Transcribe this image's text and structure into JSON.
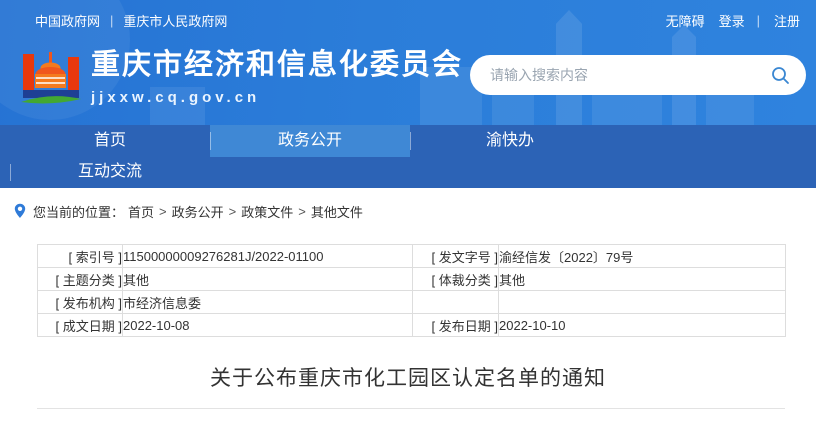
{
  "top_bar": {
    "left_links": [
      "中国政府网",
      "重庆市人民政府网"
    ],
    "right_links": [
      "无障碍",
      "登录",
      "注册"
    ],
    "divider": "|"
  },
  "header": {
    "site_name": "重庆市经济和信息化委员会",
    "site_url": "jjxxw.cq.gov.cn",
    "search_placeholder": "请输入搜索内容"
  },
  "nav": {
    "tabs": [
      {
        "label": "首页",
        "active": false
      },
      {
        "label": "政务公开",
        "active": true
      },
      {
        "label": "渝快办",
        "active": false
      },
      {
        "label": "互动交流",
        "active": false
      }
    ]
  },
  "breadcrumb": {
    "prefix": "您当前的位置：",
    "items": [
      "首页",
      "政务公开",
      "政策文件",
      "其他文件"
    ],
    "separator": ">"
  },
  "doc_meta": {
    "rows": [
      {
        "label1": "[ 索引号 ]",
        "value1": "11500000009276281J/2022-01100",
        "label2": "[ 发文字号 ]",
        "value2": "渝经信发〔2022〕79号"
      },
      {
        "label1": "[ 主题分类 ]",
        "value1": "其他",
        "label2": "[ 体裁分类 ]",
        "value2": "其他"
      },
      {
        "label1": "[ 发布机构 ]",
        "value1": "市经济信息委",
        "label2": "",
        "value2": ""
      },
      {
        "label1": "[ 成文日期 ]",
        "value1": "2022-10-08",
        "label2": "[ 发布日期 ]",
        "value2": "2022-10-10"
      }
    ]
  },
  "article": {
    "title": "关于公布重庆市化工园区认定名单的通知"
  },
  "colors": {
    "header_blue": "#2b7dd9",
    "nav_blue": "#2c63b6",
    "active_tab_blue": "#3f88d5",
    "search_icon_blue": "#3a87d2",
    "pin_blue": "#2f7bd8",
    "table_border": "#dddddd",
    "text_dark": "#333333",
    "logo_orange": "#f0561d",
    "logo_green": "#43a832",
    "logo_navy": "#1e3f94"
  }
}
